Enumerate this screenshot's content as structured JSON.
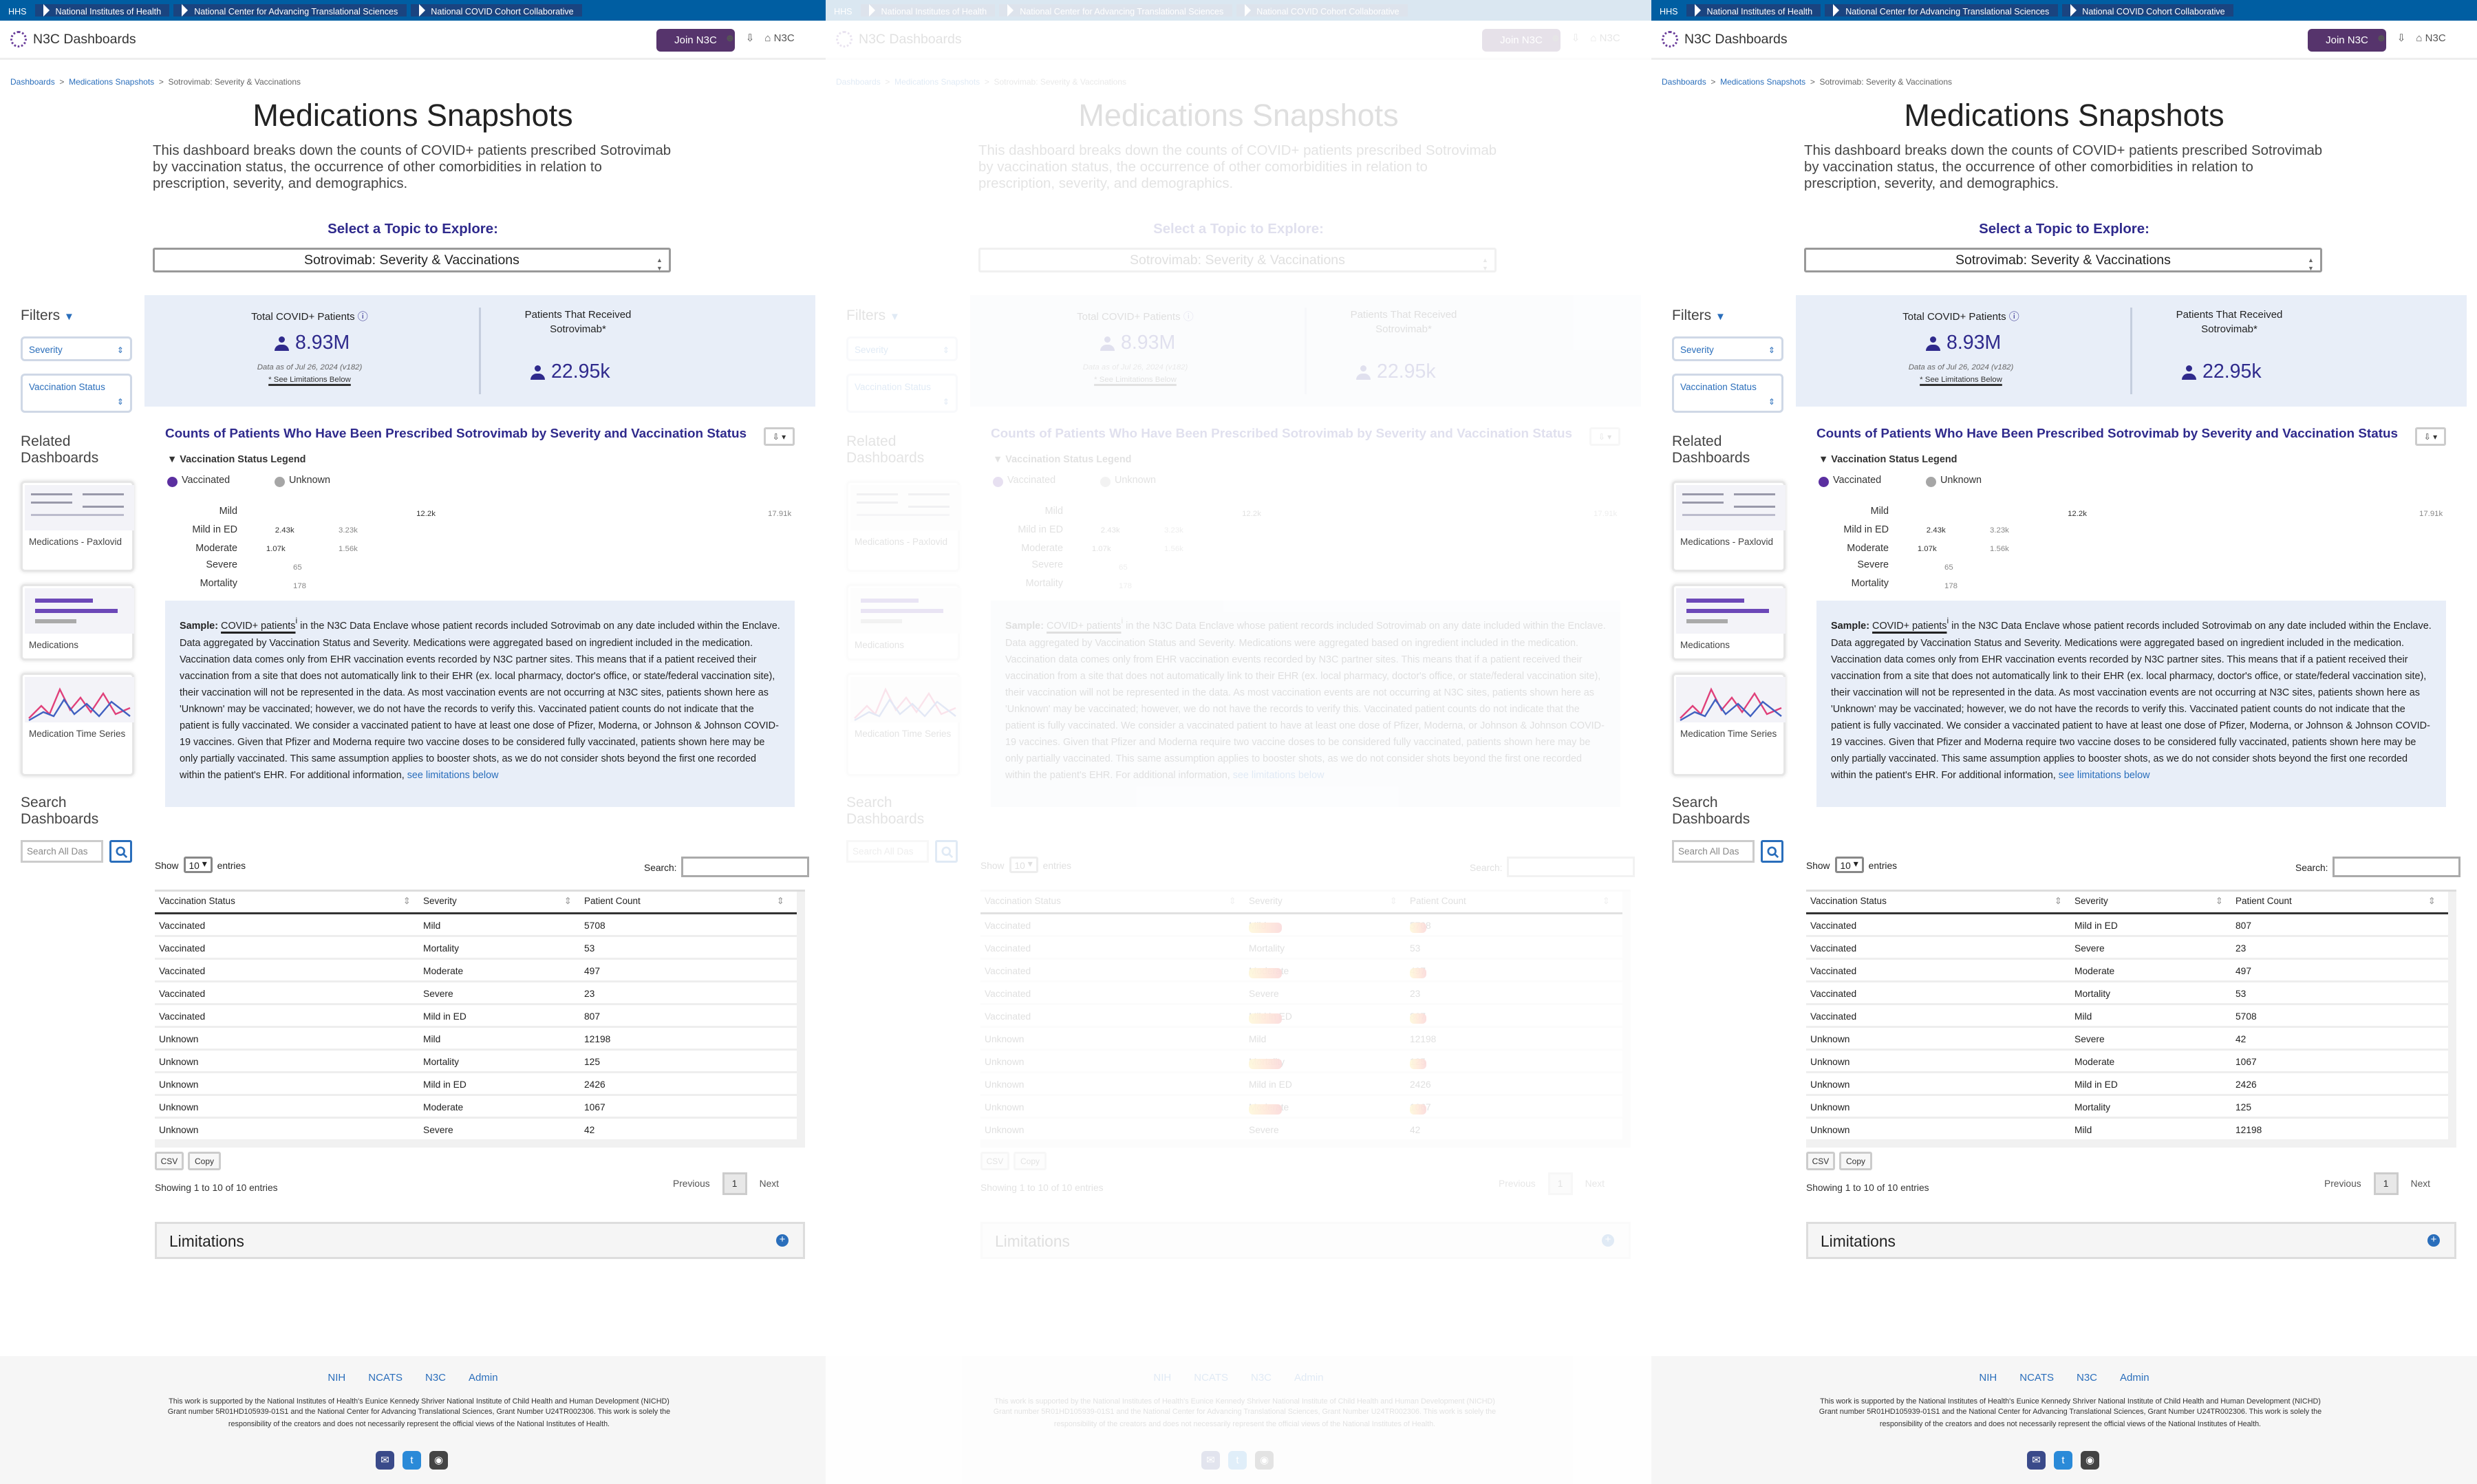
{
  "header": {
    "hhs": "HHS",
    "nih": "National Institutes of Health",
    "ncats": "National Center for Advancing Translational Sciences",
    "n3c": "National COVID Cohort Collaborative",
    "brand": "N3C Dashboards",
    "join": "Join N3C",
    "n3c_link": "N3C"
  },
  "breadcrumb": {
    "home": "Dashboards",
    "section": "Medications Snapshots",
    "current": "Sotrovimab: Severity & Vaccinations"
  },
  "page": {
    "title": "Medications Snapshots",
    "description": "This dashboard breaks down the counts of COVID+ patients prescribed Sotrovimab by vaccination status, the occurrence of other comorbidities in relation to prescription, severity, and demographics.",
    "select_prompt": "Select a Topic to Explore:",
    "topic": "Sotrovimab: Severity & Vaccinations"
  },
  "sidebar": {
    "filters": "Filters",
    "filter_items": [
      "Severity",
      "Vaccination Status"
    ],
    "related_title": "Related Dashboards",
    "related": [
      "Medications - Paxlovid",
      "Medications",
      "Medication Time Series"
    ],
    "search_title": "Search Dashboards",
    "search_placeholder": "Search All Das"
  },
  "kpi": {
    "total_label": "Total COVID+ Patients",
    "total_value": "8.93M",
    "asof": "Data as of Jul 26, 2024 (v182)",
    "limits_link": "* See Limitations Below",
    "received_label": "Patients That Received Sotrovimab*",
    "received_value": "22.95k"
  },
  "chart": {
    "title": "Counts of Patients Who Have Been Prescribed Sotrovimab by Severity and Vaccination Status",
    "legend_title": "Vaccination Status Legend",
    "legend": [
      {
        "label": "Vaccinated",
        "color": "#5b2fa0"
      },
      {
        "label": "Unknown",
        "color": "#a6a6a6"
      }
    ]
  },
  "chart_data": {
    "type": "bar",
    "categories": [
      "Mild",
      "Mild in ED",
      "Moderate",
      "Severe",
      "Mortality"
    ],
    "series": [
      {
        "name": "Vaccinated",
        "values": [
          5708,
          807,
          497,
          23,
          53
        ]
      },
      {
        "name": "Unknown",
        "values": [
          12198,
          2426,
          1067,
          42,
          125
        ]
      }
    ],
    "bar_labels": [
      "12.2k",
      "2.43k",
      "1.07k",
      "",
      ""
    ],
    "total_labels": [
      "17.91k",
      "3.23k",
      "1.56k",
      "65",
      "178"
    ],
    "max": 17906
  },
  "sample": {
    "label": "Sample:",
    "link": "COVID+ patients",
    "text": " in the N3C Data Enclave whose patient records included Sotrovimab on any date included within the Enclave. Data aggregated by Vaccination Status and Severity. Medications were aggregated based on ingredient included in the medication. Vaccination data comes only from EHR vaccination events recorded by N3C partner sites. This means that if a patient received their vaccination from a site that does not automatically link to their EHR (ex. local pharmacy, doctor's office, or state/federal vaccination site), their vaccination will not be represented in the data. As most vaccination events are not occurring at N3C sites, patients shown here as 'Unknown' may be vaccinated; however, we do not have the records to verify this. Vaccinated patient counts do not indicate that the patient is fully vaccinated. We consider a vaccinated patient to have at least one dose of Pfizer, Moderna, or Johnson & Johnson COVID-19 vaccines. Given that Pfizer and Moderna require two vaccine doses to be considered fully vaccinated, patients shown here may be only partially vaccinated. This same assumption applies to booster shots, as we do not consider shots beyond the first one recorded within the patient's EHR. For additional information, ",
    "tail_link": "see limitations below"
  },
  "table": {
    "show": "Show",
    "entries_value": "10",
    "entries": "entries",
    "search_label": "Search:",
    "columns": [
      "Vaccination Status",
      "Severity",
      "Patient Count"
    ],
    "rows_a": [
      [
        "Vaccinated",
        "Mild",
        "5708"
      ],
      [
        "Vaccinated",
        "Mortality",
        "53"
      ],
      [
        "Vaccinated",
        "Moderate",
        "497"
      ],
      [
        "Vaccinated",
        "Severe",
        "23"
      ],
      [
        "Vaccinated",
        "Mild in ED",
        "807"
      ],
      [
        "Unknown",
        "Mild",
        "12198"
      ],
      [
        "Unknown",
        "Mortality",
        "125"
      ],
      [
        "Unknown",
        "Mild in ED",
        "2426"
      ],
      [
        "Unknown",
        "Moderate",
        "1067"
      ],
      [
        "Unknown",
        "Severe",
        "42"
      ]
    ],
    "rows_b": [
      [
        "Vaccinated",
        "Mild in ED",
        "807"
      ],
      [
        "Vaccinated",
        "Severe",
        "23"
      ],
      [
        "Vaccinated",
        "Moderate",
        "497"
      ],
      [
        "Vaccinated",
        "Mortality",
        "53"
      ],
      [
        "Vaccinated",
        "Mild",
        "5708"
      ],
      [
        "Unknown",
        "Severe",
        "42"
      ],
      [
        "Unknown",
        "Moderate",
        "1067"
      ],
      [
        "Unknown",
        "Mild in ED",
        "2426"
      ],
      [
        "Unknown",
        "Mortality",
        "125"
      ],
      [
        "Unknown",
        "Mild",
        "12198"
      ]
    ],
    "csv": "CSV",
    "copy": "Copy",
    "showing": "Showing 1 to 10 of 10 entries",
    "previous": "Previous",
    "page": "1",
    "next": "Next"
  },
  "limitations": "Limitations",
  "footer": {
    "links": [
      "NIH",
      "NCATS",
      "N3C",
      "Admin"
    ],
    "text": "This work is supported by the National Institutes of Health's Eunice Kennedy Shriver National Institute of Child Health and Human Development (NICHD) Grant number 5R01HD105939-01S1 and the National Center for Advancing Translational Sciences, Grant Number U24TR002306. This work is solely the responsibility of the creators and does not necessarily represent the official views of the National Institutes of Health."
  }
}
